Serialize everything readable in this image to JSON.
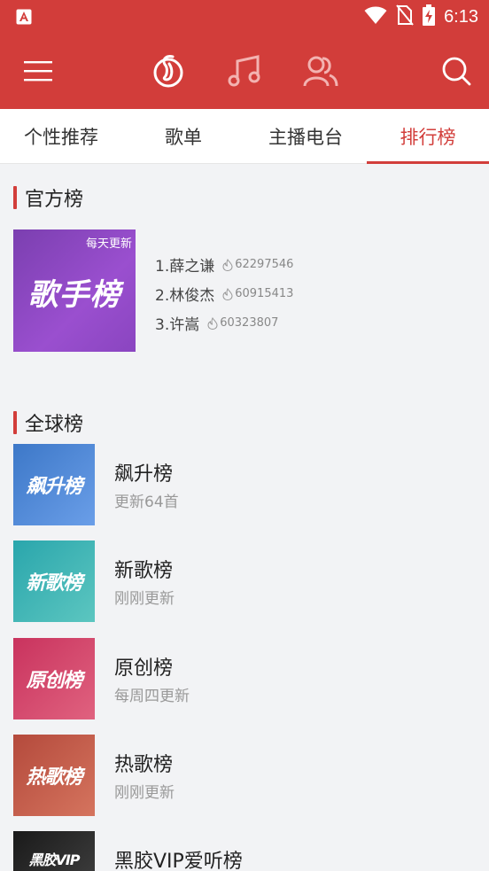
{
  "status_bar": {
    "time": "6:13",
    "icons": [
      "app-notification-icon",
      "wifi-icon",
      "no-sim-icon",
      "battery-charging-icon"
    ]
  },
  "app_bar": {
    "icons": [
      "menu-icon",
      "netease-music-icon",
      "music-note-icon",
      "friends-icon",
      "search-icon"
    ]
  },
  "tabs": [
    {
      "label": "个性推荐",
      "active": false
    },
    {
      "label": "歌单",
      "active": false
    },
    {
      "label": "主播电台",
      "active": false
    },
    {
      "label": "排行榜",
      "active": true
    }
  ],
  "official": {
    "title": "官方榜",
    "card": {
      "update": "每天更新",
      "logo": "歌手榜"
    },
    "items": [
      {
        "rank_name": "1.薛之谦",
        "heat": "62297546"
      },
      {
        "rank_name": "2.林俊杰",
        "heat": "60915413"
      },
      {
        "rank_name": "3.许嵩",
        "heat": "60323807"
      }
    ]
  },
  "global": {
    "title": "全球榜",
    "items": [
      {
        "cover_text": "飙升榜",
        "name": "飙升榜",
        "sub": "更新64首",
        "color_a": "#3d78c8",
        "color_b": "#6a9ee8"
      },
      {
        "cover_text": "新歌榜",
        "name": "新歌榜",
        "sub": "刚刚更新",
        "color_a": "#2aa6ac",
        "color_b": "#5cc6c0"
      },
      {
        "cover_text": "原创榜",
        "name": "原创榜",
        "sub": "每周四更新",
        "color_a": "#c9335e",
        "color_b": "#e0627f"
      },
      {
        "cover_text": "热歌榜",
        "name": "热歌榜",
        "sub": "刚刚更新",
        "color_a": "#b44a3c",
        "color_b": "#d5745e"
      },
      {
        "cover_text": "黑胶VIP",
        "name": "黑胶VIP爱听榜",
        "sub": "",
        "color_a": "#1a1a1a",
        "color_b": "#3a3a3a"
      }
    ]
  },
  "colors": {
    "accent": "#d23d3a",
    "background": "#f2f3f5"
  }
}
